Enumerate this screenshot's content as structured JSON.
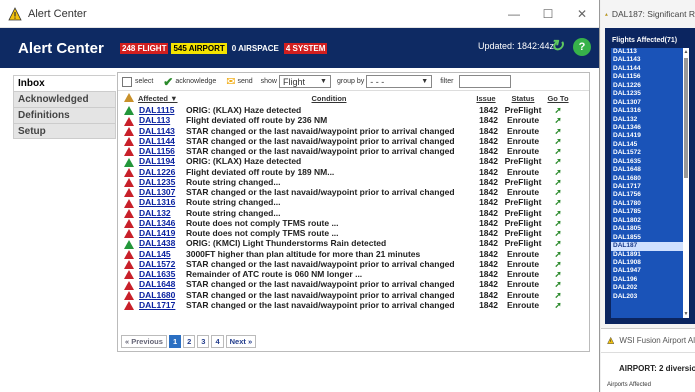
{
  "window": {
    "title": "Alert Center",
    "minimize": "—",
    "maximize": "☐",
    "close": "✕"
  },
  "header": {
    "title": "Alert Center",
    "counts": [
      {
        "value": "248 FLIGHT",
        "style": "red"
      },
      {
        "value": "545 AIRPORT",
        "style": "yellow"
      },
      {
        "value": "0 AIRSPACE",
        "style": "plain"
      },
      {
        "value": "4 SYSTEM",
        "style": "red"
      }
    ],
    "updated": "Updated: 1842:44z",
    "refresh_glyph": "↻",
    "help_glyph": "?"
  },
  "nav": {
    "items": [
      "Inbox",
      "Acknowledged",
      "Definitions",
      "Setup"
    ],
    "active": "Inbox"
  },
  "toolbar": {
    "select_label": "select",
    "acknowledge_label": "acknowledge",
    "send_label": "send",
    "show_label": "show",
    "show_value": "Flight",
    "group_label": "group by",
    "group_value": "- - -",
    "filter_label": "filter"
  },
  "table": {
    "headers": {
      "affected": "Affected ▼",
      "condition": "Condition",
      "issue": "Issue",
      "status": "Status",
      "goto": "Go To"
    },
    "rows": [
      {
        "sev": "green",
        "id": "DAL1115",
        "cond": "ORIG: (KLAX) Haze detected",
        "issue": "1842",
        "status": "PreFlight"
      },
      {
        "sev": "red",
        "id": "DAL113",
        "cond": "Flight deviated off route by 236 NM",
        "issue": "1842",
        "status": "Enroute"
      },
      {
        "sev": "red",
        "id": "DAL1143",
        "cond": "STAR changed or the last navaid/waypoint prior to arrival changed",
        "issue": "1842",
        "status": "Enroute"
      },
      {
        "sev": "red",
        "id": "DAL1144",
        "cond": "STAR changed or the last navaid/waypoint prior to arrival changed",
        "issue": "1842",
        "status": "Enroute"
      },
      {
        "sev": "red",
        "id": "DAL1156",
        "cond": "STAR changed or the last navaid/waypoint prior to arrival changed",
        "issue": "1842",
        "status": "Enroute"
      },
      {
        "sev": "green",
        "id": "DAL1194",
        "cond": "ORIG: (KLAX) Haze detected",
        "issue": "1842",
        "status": "PreFlight"
      },
      {
        "sev": "red",
        "id": "DAL1226",
        "cond": "Flight deviated off route by 189 NM...",
        "issue": "1842",
        "status": "Enroute"
      },
      {
        "sev": "red",
        "id": "DAL1235",
        "cond": "Route string changed...",
        "issue": "1842",
        "status": "PreFlight"
      },
      {
        "sev": "red",
        "id": "DAL1307",
        "cond": "STAR changed or the last navaid/waypoint prior to arrival changed",
        "issue": "1842",
        "status": "Enroute"
      },
      {
        "sev": "red",
        "id": "DAL1316",
        "cond": "Route string changed...",
        "issue": "1842",
        "status": "PreFlight"
      },
      {
        "sev": "red",
        "id": "DAL132",
        "cond": "Route string changed...",
        "issue": "1842",
        "status": "PreFlight"
      },
      {
        "sev": "red",
        "id": "DAL1346",
        "cond": "Route does not comply TFMS route ...",
        "issue": "1842",
        "status": "PreFlight"
      },
      {
        "sev": "red",
        "id": "DAL1419",
        "cond": "Route does not comply TFMS route ...",
        "issue": "1842",
        "status": "PreFlight"
      },
      {
        "sev": "green",
        "id": "DAL1438",
        "cond": "ORIG: (KMCI) Light Thunderstorms Rain detected",
        "issue": "1842",
        "status": "PreFlight"
      },
      {
        "sev": "red",
        "id": "DAL145",
        "cond": "3000FT higher than plan altitude for more than 21 minutes",
        "issue": "1842",
        "status": "Enroute"
      },
      {
        "sev": "red",
        "id": "DAL1572",
        "cond": "STAR changed or the last navaid/waypoint prior to arrival changed",
        "issue": "1842",
        "status": "Enroute"
      },
      {
        "sev": "red",
        "id": "DAL1635",
        "cond": "Remainder of ATC route is 060 NM longer ...",
        "issue": "1842",
        "status": "Enroute"
      },
      {
        "sev": "red",
        "id": "DAL1648",
        "cond": "STAR changed or the last navaid/waypoint prior to arrival changed",
        "issue": "1842",
        "status": "Enroute"
      },
      {
        "sev": "red",
        "id": "DAL1680",
        "cond": "STAR changed or the last navaid/waypoint prior to arrival changed",
        "issue": "1842",
        "status": "Enroute"
      },
      {
        "sev": "red",
        "id": "DAL1717",
        "cond": "STAR changed or the last navaid/waypoint prior to arrival changed",
        "issue": "1842",
        "status": "Enroute"
      }
    ]
  },
  "pager": {
    "previous": "« Previous",
    "pages": [
      "1",
      "2",
      "3",
      "4"
    ],
    "current": "1",
    "next": "Next »"
  },
  "side": {
    "title": "DAL187: Significant R",
    "flights_header": "Flights Affected(71)",
    "flights": [
      "DAL113",
      "DAL1143",
      "DAL1144",
      "DAL1156",
      "DAL1226",
      "DAL1235",
      "DAL1307",
      "DAL1316",
      "DAL132",
      "DAL1346",
      "DAL1419",
      "DAL145",
      "DAL1572",
      "DAL1635",
      "DAL1648",
      "DAL1680",
      "DAL1717",
      "DAL1756",
      "DAL1780",
      "DAL1785",
      "DAL1802",
      "DAL1805",
      "DAL1855",
      "DAL187",
      "DAL1891",
      "DAL1908",
      "DAL1947",
      "DAL196",
      "DAL202",
      "DAL203"
    ],
    "selected": "DAL187",
    "fusion_title": "WSI Fusion Airport Al",
    "fusion_line": "AIRPORT: 2 diversio",
    "fusion_sub": "Airports Affected"
  },
  "colors": {
    "header_bg": "#0e2a63",
    "alert_red": "#c8202a",
    "alert_green": "#23963a",
    "link": "#0a22a0",
    "list_bg": "#1a53b8"
  }
}
